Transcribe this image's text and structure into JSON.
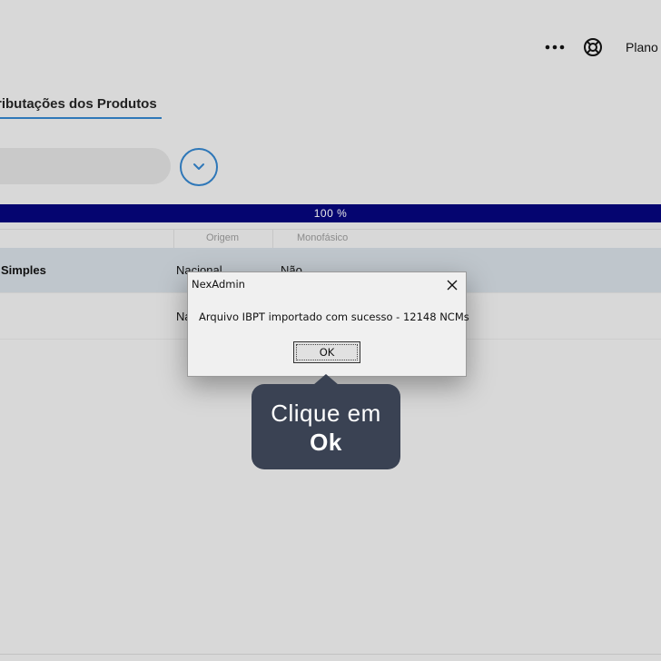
{
  "header": {
    "more_icon": "more-horizontal-icon",
    "help_icon": "lifebuoy-icon",
    "plan_label": "Plano"
  },
  "tabs": {
    "active_label": "ributações dos Produtos"
  },
  "toolbar": {
    "expand_icon": "chevron-down-icon"
  },
  "progress": {
    "value": 1.0,
    "label": "100 %",
    "bar_color": "#050570"
  },
  "table": {
    "columns": [
      "Origem",
      "Monofásico"
    ],
    "rows": [
      {
        "regime": "Simples",
        "origem": "Nacional",
        "monofasico": "Não"
      },
      {
        "regime": "",
        "origem": "Na",
        "monofasico": ""
      }
    ],
    "selected_row_color": "#bfc6cc"
  },
  "dialog": {
    "title": "NexAdmin",
    "message": "Arquivo IBPT importado com sucesso - 12148 NCMs",
    "ok_label": "OK",
    "close_icon": "close-icon"
  },
  "tooltip": {
    "line1": "Clique em",
    "line2": "Ok",
    "color": "#3a4253"
  },
  "colors": {
    "accent": "#2e77b8",
    "overlay_bg": "#d8d8d8"
  }
}
